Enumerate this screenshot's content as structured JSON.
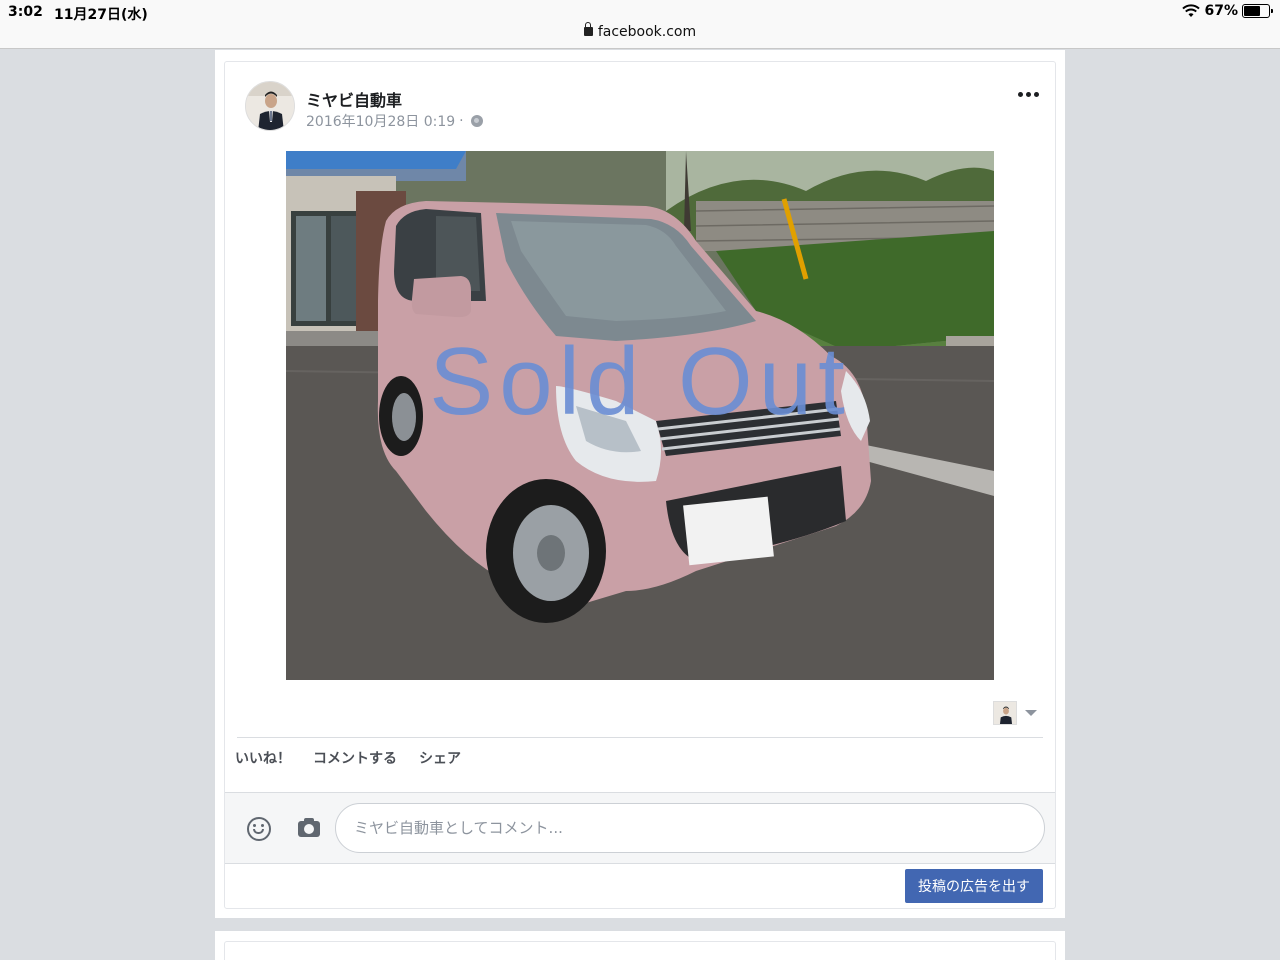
{
  "status_bar": {
    "time": "3:02",
    "date": "11月27日(水)",
    "battery": "67%",
    "battery_level": 0.67
  },
  "browser": {
    "url": "facebook.com"
  },
  "post": {
    "page_name": "ミヤビ自動車",
    "timestamp": "2016年10月28日 0:19",
    "separator": "·",
    "photo_overlay_text": "Sold Out",
    "actions": {
      "like": "いいね！",
      "comment": "コメントする",
      "share": "シェア"
    },
    "comment_placeholder": "ミヤビ自動車としてコメント...",
    "boost_button": "投稿の広告を出す"
  },
  "colors": {
    "accent": "#4267b2",
    "overlay_text": "#6a8ed4",
    "car": "#c9a0a6"
  },
  "icons": [
    "lock-icon",
    "wifi-icon",
    "battery-icon",
    "globe-icon",
    "more-options-icon",
    "emoji-icon",
    "camera-icon",
    "dropdown-caret-icon"
  ]
}
